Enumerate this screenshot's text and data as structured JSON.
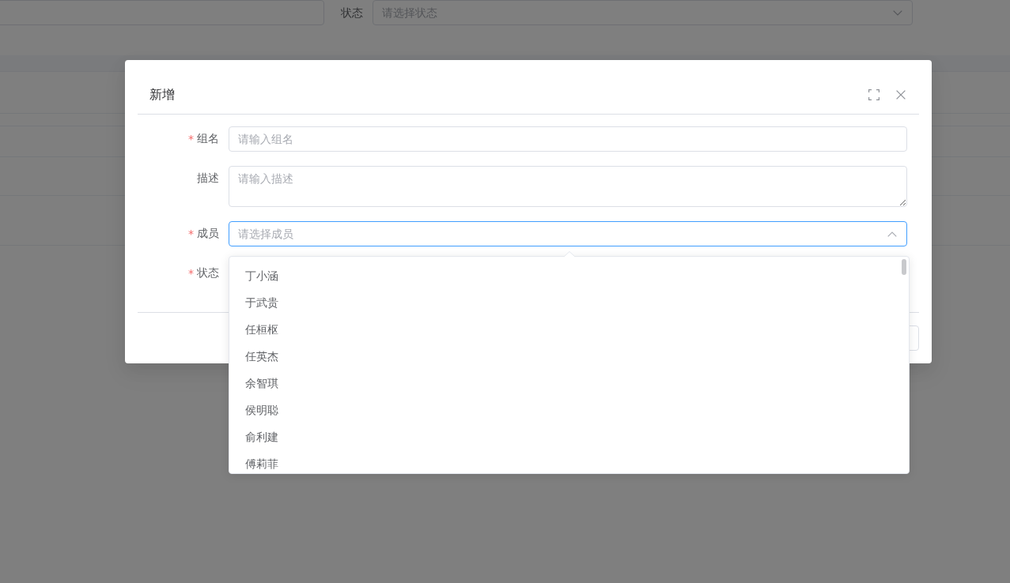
{
  "filters": [
    {
      "kind": "input"
    },
    {
      "kind": "select",
      "label": "状态",
      "placeholder": "请选择状态",
      "expanded": false
    }
  ],
  "dialog": {
    "title": "新增",
    "required_mark": "*",
    "form": [
      {
        "kind": "input",
        "label": "组名",
        "required": true,
        "placeholder": "请输入组名"
      },
      {
        "kind": "textarea",
        "label": "描述",
        "required": false,
        "placeholder": "请输入描述"
      },
      {
        "kind": "select",
        "label": "成员",
        "required": true,
        "placeholder": "请选择成员",
        "focused": true,
        "expanded": true,
        "options": [
          {
            "label": "丁小涵",
            "selected": false
          },
          {
            "label": "于武贵",
            "selected": false
          },
          {
            "label": "任桓枢",
            "selected": false
          },
          {
            "label": "任英杰",
            "selected": false
          },
          {
            "label": "余智琪",
            "selected": false
          },
          {
            "label": "侯明聪",
            "selected": false
          },
          {
            "label": "俞利建",
            "selected": false
          },
          {
            "label": "傅莉菲",
            "selected": false
          }
        ]
      },
      {
        "kind": "select",
        "label": "状态",
        "required": true
      }
    ]
  }
}
